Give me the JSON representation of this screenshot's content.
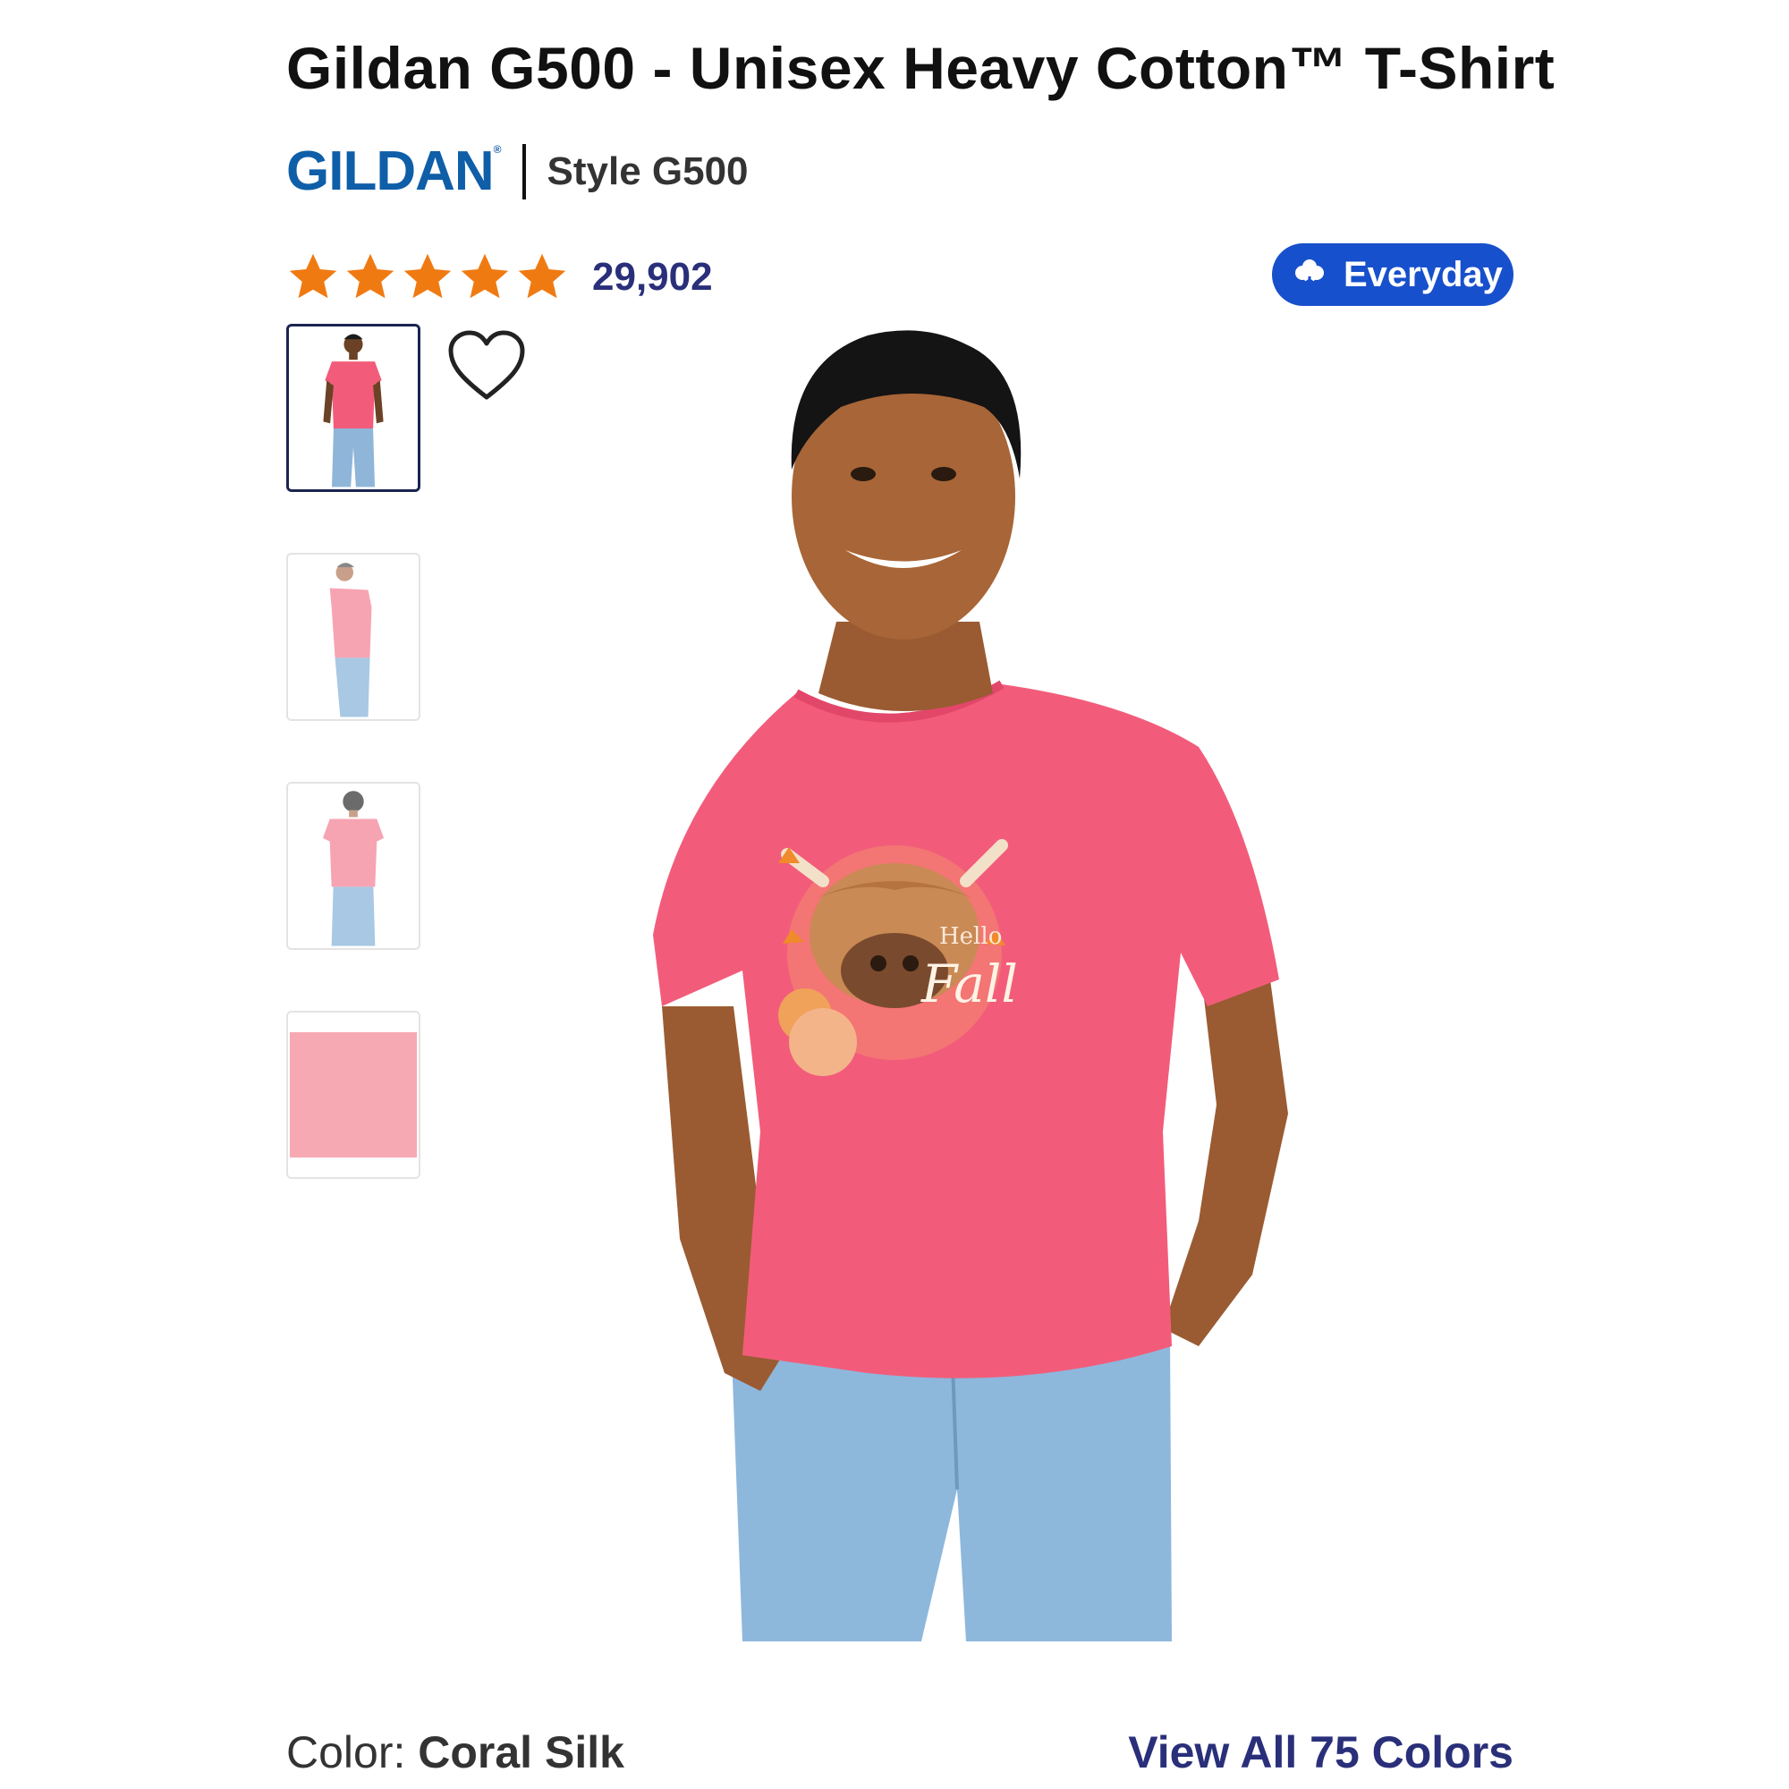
{
  "product": {
    "title": "Gildan G500 - Unisex Heavy Cotton™ T-Shirt",
    "brand_logo_text": "GILDAN",
    "style_label": "Style G500"
  },
  "rating": {
    "stars": 5,
    "review_count": "29,902",
    "star_color": "#f07a12"
  },
  "badge": {
    "label": "Everyday",
    "icon": "cotton-flower-icon",
    "color": "#1750cc"
  },
  "gallery": {
    "thumbnails": [
      {
        "name": "front-view",
        "selected": true
      },
      {
        "name": "side-view",
        "selected": false
      },
      {
        "name": "back-view",
        "selected": false
      },
      {
        "name": "color-swatch",
        "selected": false
      }
    ],
    "main_image": "model-wearing-coral-tshirt",
    "print_text_top": "Hello",
    "print_text_main": "Fall"
  },
  "color": {
    "label": "Color: ",
    "value": "Coral Silk",
    "swatch_hex": "#f6a9b2",
    "view_all_label": "View All 75 Colors"
  },
  "colors": {
    "title_text": "#111111",
    "link": "#2a2f7a",
    "shirt": "#f25c7a",
    "brand": "#0f5ea8"
  }
}
